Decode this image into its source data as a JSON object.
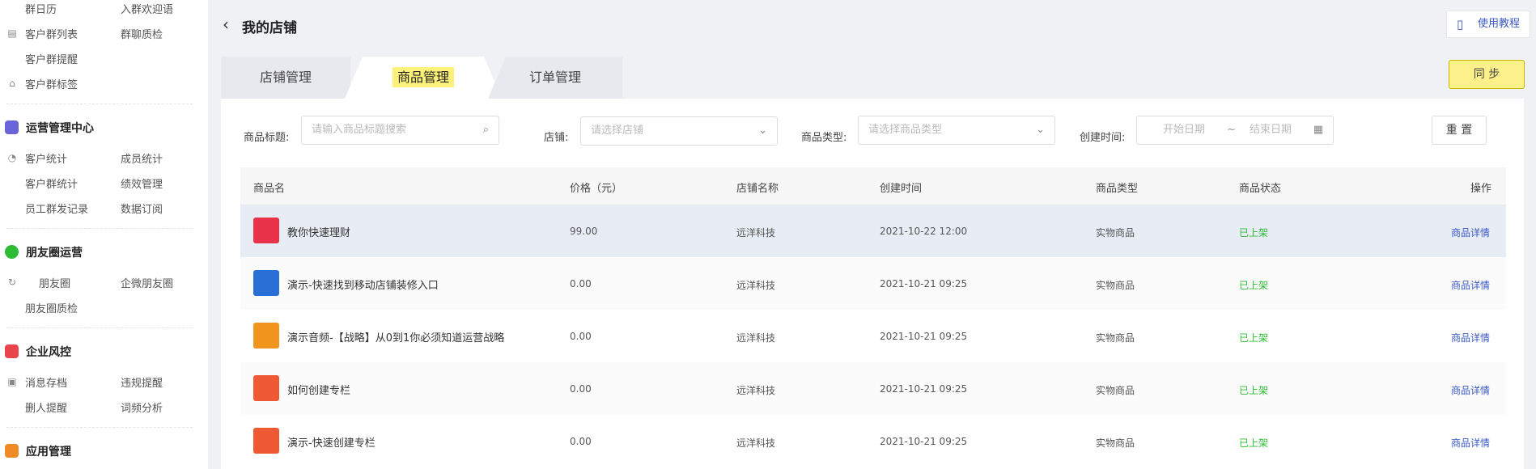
{
  "sidebar": {
    "rows": [
      {
        "icon": "",
        "c1": "群日历",
        "c2": "入群欢迎语"
      },
      {
        "icon": "list",
        "c1": "客户群列表",
        "c2": "群聊质检"
      },
      {
        "icon": "",
        "c1": "客户群提醒",
        "c2": ""
      },
      {
        "icon": "tag",
        "c1": "客户群标签",
        "c2": ""
      },
      {
        "icon": "pie",
        "c1": "客户统计",
        "c2": "成员统计"
      },
      {
        "icon": "",
        "c1": "客户群统计",
        "c2": "绩效管理"
      },
      {
        "icon": "",
        "c1": "员工群发记录",
        "c2": "数据订阅"
      },
      {
        "icon": "moments",
        "c1": "朋友圈",
        "c2": "企微朋友圈"
      },
      {
        "icon": "",
        "c1": "朋友圈质检",
        "c2": ""
      },
      {
        "icon": "archive",
        "c1": "消息存档",
        "c2": "违规提醒"
      },
      {
        "icon": "",
        "c1": "删人提醒",
        "c2": "词频分析"
      }
    ],
    "sections": [
      {
        "title": "运营管理中心",
        "color": "#6b63d8"
      },
      {
        "title": "朋友圈运营",
        "color": "#2dbc33"
      },
      {
        "title": "企业风控",
        "color": "#e8454c"
      },
      {
        "title": "应用管理",
        "color": "#f08a24"
      }
    ]
  },
  "header": {
    "title": "我的店铺",
    "tutorial": "使用教程"
  },
  "tabs": [
    {
      "label": "店铺管理"
    },
    {
      "label": "商品管理"
    },
    {
      "label": "订单管理"
    }
  ],
  "sync_label": "同 步",
  "filters": {
    "title_label": "商品标题:",
    "title_placeholder": "请输入商品标题搜索",
    "store_label": "店铺:",
    "store_placeholder": "请选择店铺",
    "type_label": "商品类型:",
    "type_placeholder": "请选择商品类型",
    "time_label": "创建时间:",
    "start_placeholder": "开始日期",
    "range_sep": "~",
    "end_placeholder": "结束日期",
    "reset": "重 置"
  },
  "table": {
    "headers": [
      "商品名",
      "价格（元）",
      "店铺名称",
      "创建时间",
      "商品类型",
      "商品状态",
      "操作"
    ],
    "rows": [
      {
        "name": "教你快速理财",
        "price": "99.00",
        "store": "远洋科技",
        "created": "2021-10-22 12:00",
        "type": "实物商品",
        "status": "已上架",
        "op": "商品详情",
        "thumb": "#e8334a"
      },
      {
        "name": "演示-快速找到移动店铺装修入口",
        "price": "0.00",
        "store": "远洋科技",
        "created": "2021-10-21 09:25",
        "type": "实物商品",
        "status": "已上架",
        "op": "商品详情",
        "thumb": "#2a6fd6"
      },
      {
        "name": "演示音频-【战略】从0到1你必须知道运营战略",
        "price": "0.00",
        "store": "远洋科技",
        "created": "2021-10-21 09:25",
        "type": "实物商品",
        "status": "已上架",
        "op": "商品详情",
        "thumb": "#f2951f"
      },
      {
        "name": "如何创建专栏",
        "price": "0.00",
        "store": "远洋科技",
        "created": "2021-10-21 09:25",
        "type": "实物商品",
        "status": "已上架",
        "op": "商品详情",
        "thumb": "#ef5a35"
      },
      {
        "name": "演示-快速创建专栏",
        "price": "0.00",
        "store": "远洋科技",
        "created": "2021-10-21 09:25",
        "type": "实物商品",
        "status": "已上架",
        "op": "商品详情",
        "thumb": "#ef5a35"
      }
    ]
  }
}
